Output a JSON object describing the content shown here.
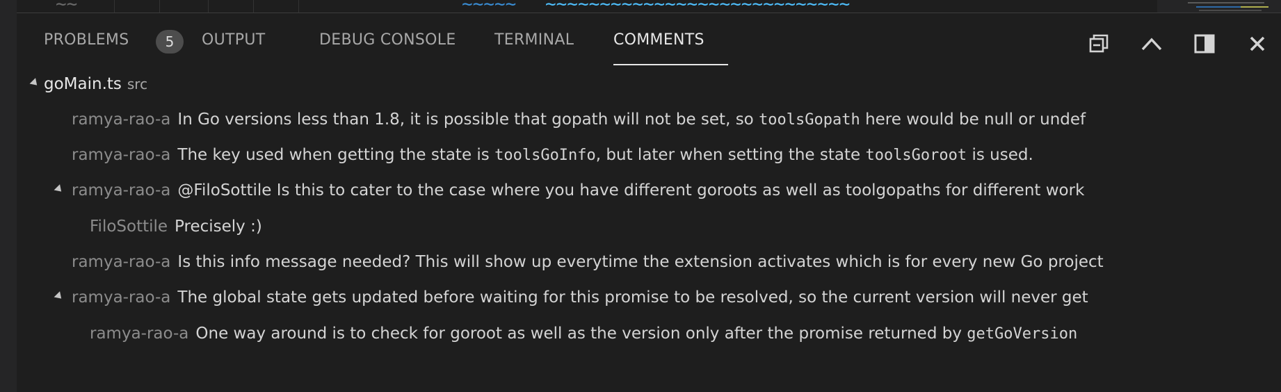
{
  "panel": {
    "tabs": [
      {
        "label": "PROBLEMS",
        "badge": "5"
      },
      {
        "label": "OUTPUT"
      },
      {
        "label": "DEBUG CONSOLE"
      },
      {
        "label": "TERMINAL"
      },
      {
        "label": "COMMENTS",
        "active": true
      }
    ],
    "actions": [
      "collapse-all-icon",
      "chevron-up-icon",
      "maximize-panel-icon",
      "close-icon"
    ]
  },
  "tree": {
    "file": {
      "name": "goMain.ts",
      "folder": "src"
    },
    "comments": [
      {
        "author": "ramya-rao-a",
        "parts": [
          {
            "t": "In Go versions less than 1.8, it is possible that gopath will not be set, so "
          },
          {
            "c": "toolsGopath"
          },
          {
            "t": " here would be null or undef"
          }
        ]
      },
      {
        "author": "ramya-rao-a",
        "parts": [
          {
            "t": "The key used when getting the state is "
          },
          {
            "c": "toolsGoInfo"
          },
          {
            "t": ", but later when setting the state "
          },
          {
            "c": "toolsGoroot"
          },
          {
            "t": " is used."
          }
        ]
      },
      {
        "author": "ramya-rao-a",
        "expanded": true,
        "parts": [
          {
            "t": "@FiloSottile Is this to cater to the case where you have different goroots as well as toolgopaths for different work"
          }
        ],
        "replies": [
          {
            "author": "FiloSottile",
            "parts": [
              {
                "t": "Precisely :)"
              }
            ]
          }
        ]
      },
      {
        "author": "ramya-rao-a",
        "parts": [
          {
            "t": "Is this info message needed? This will show up everytime the extension activates which is for every new Go project"
          }
        ]
      },
      {
        "author": "ramya-rao-a",
        "expanded": true,
        "parts": [
          {
            "t": "The global state gets updated before waiting for this promise to be resolved, so the current version will never get"
          }
        ],
        "replies": [
          {
            "author": "ramya-rao-a",
            "parts": [
              {
                "t": "One way around is to check for goroot as well as the version only after the promise returned by "
              },
              {
                "c": "getGoVersion"
              }
            ]
          }
        ]
      }
    ]
  },
  "colors": {
    "background": "#1e1e1e",
    "active_tab": "#e7e7e7",
    "inactive_tab": "#a8a8a8",
    "author": "#8c8c8c",
    "badge": "#4d4d4d"
  }
}
